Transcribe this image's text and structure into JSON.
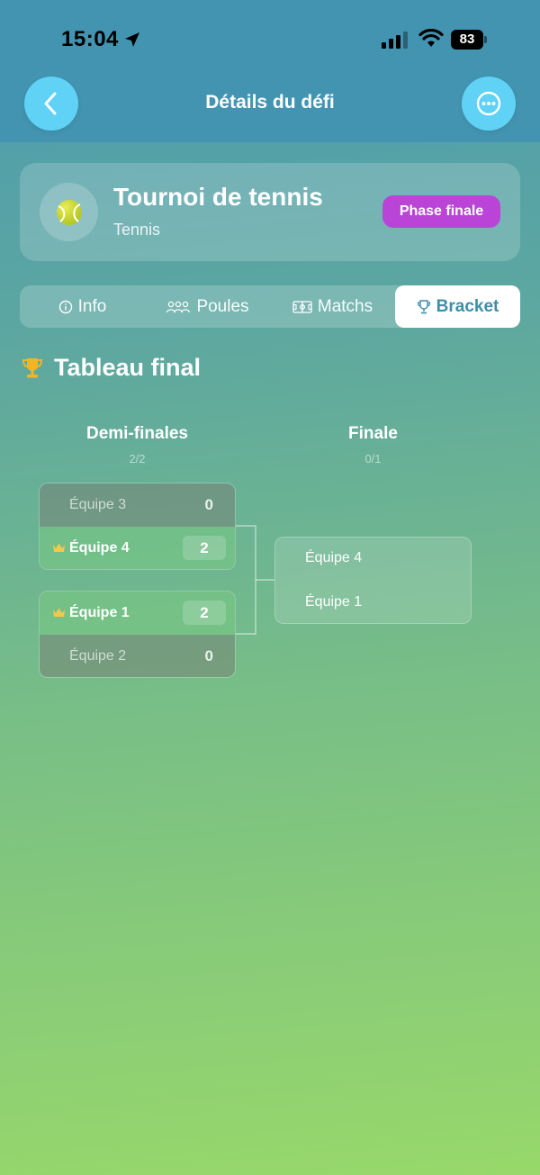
{
  "status_bar": {
    "time": "15:04",
    "battery": "83"
  },
  "nav": {
    "title": "Détails du défi"
  },
  "challenge": {
    "title": "Tournoi de tennis",
    "sport": "Tennis",
    "phase": "Phase finale",
    "phase_color": "#bb44d8"
  },
  "tabs": [
    {
      "label": "Info",
      "icon": "info-icon"
    },
    {
      "label": "Poules",
      "icon": "groups-icon"
    },
    {
      "label": "Matchs",
      "icon": "field-icon"
    },
    {
      "label": "Bracket",
      "icon": "trophy-icon",
      "active": true
    }
  ],
  "bracket": {
    "title": "Tableau final",
    "rounds": [
      {
        "name": "Demi-finales",
        "progress": "2/2"
      },
      {
        "name": "Finale",
        "progress": "0/1"
      }
    ],
    "semifinals": [
      {
        "team_a": {
          "name": "Équipe 3",
          "score": "0",
          "winner": false
        },
        "team_b": {
          "name": "Équipe 4",
          "score": "2",
          "winner": true
        }
      },
      {
        "team_a": {
          "name": "Équipe 1",
          "score": "2",
          "winner": true
        },
        "team_b": {
          "name": "Équipe 2",
          "score": "0",
          "winner": false
        }
      }
    ],
    "final": {
      "team_a": "Équipe 4",
      "team_b": "Équipe 1"
    }
  },
  "colors": {
    "accent": "#5fd2f6",
    "active_tab_text": "#3d8ea8",
    "crown": "#f2c94c"
  }
}
